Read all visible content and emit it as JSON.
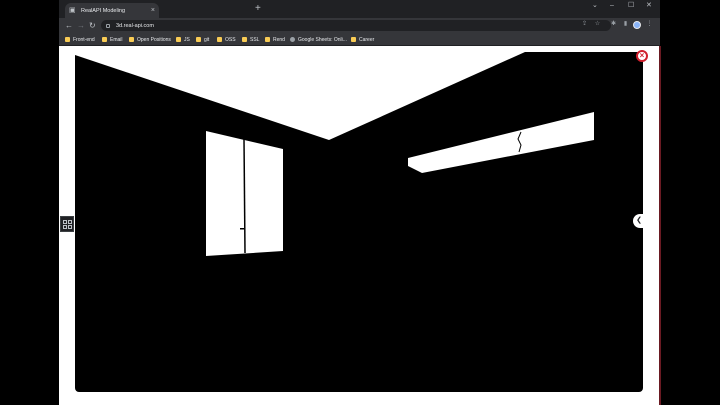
{
  "browser": {
    "tab": {
      "title": "RealAPI Modeling"
    },
    "url": "3d.real-api.com",
    "window_controls": {
      "chevron": "⌄",
      "minimize": "–",
      "maximize": "☐",
      "close": "✕"
    },
    "bookmarks": [
      {
        "label": "Front-end",
        "icon": "folder-icon"
      },
      {
        "label": "Email",
        "icon": "folder-icon"
      },
      {
        "label": "Open Positions",
        "icon": "folder-icon"
      },
      {
        "label": "JS",
        "icon": "folder-icon"
      },
      {
        "label": "git",
        "icon": "folder-icon"
      },
      {
        "label": "OSS",
        "icon": "folder-icon"
      },
      {
        "label": "SSL",
        "icon": "folder-icon"
      },
      {
        "label": "Rend",
        "icon": "folder-icon"
      },
      {
        "label": "Google Sheets: Onli...",
        "icon": "globe-icon"
      },
      {
        "label": "Career",
        "icon": "folder-icon"
      }
    ]
  },
  "viewer": {
    "close_button": "×",
    "edge_toggle": "❮",
    "grid_button_icon": "grid-icon",
    "colors": {
      "walls": "#000000",
      "openings": "#ffffff",
      "close_ring": "#d01f2c"
    }
  }
}
